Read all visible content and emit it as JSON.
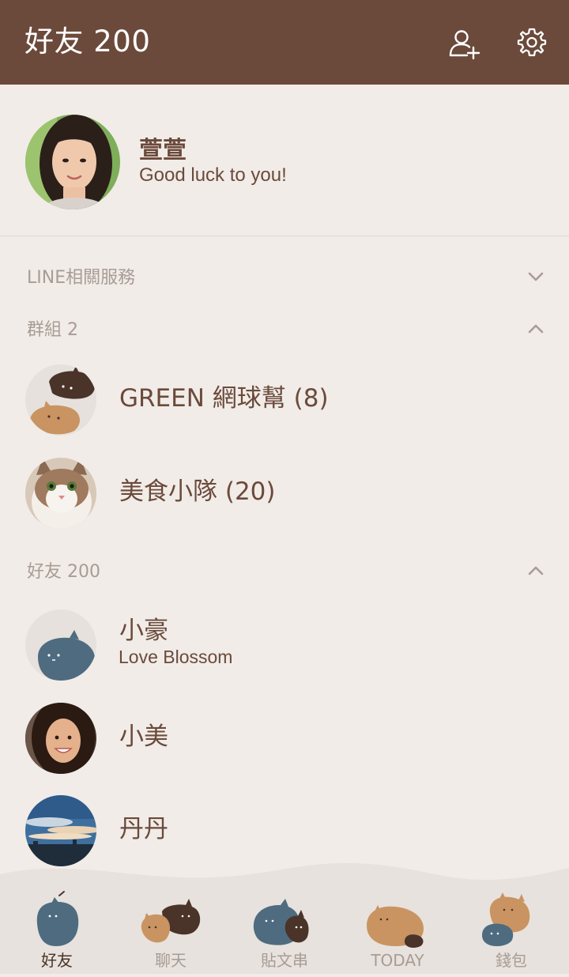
{
  "header": {
    "title": "好友 200",
    "add_friend_icon": "add-friend-icon",
    "settings_icon": "gear-icon"
  },
  "profile": {
    "name": "萱萱",
    "status": "Good luck to you!"
  },
  "sections": {
    "services": {
      "label": "LINE相關服務",
      "state": "collapsed"
    },
    "groups": {
      "label": "群組 2",
      "state": "expanded"
    },
    "friends": {
      "label": "好友 200",
      "state": "expanded"
    }
  },
  "groups": [
    {
      "name": "GREEN 網球幫 (8)"
    },
    {
      "name": "美食小隊 (20)"
    }
  ],
  "friends": [
    {
      "name": "小豪",
      "status": "Love Blossom"
    },
    {
      "name": "小美",
      "status": ""
    },
    {
      "name": "丹丹",
      "status": ""
    }
  ],
  "tabs": [
    {
      "label": "好友",
      "active": true
    },
    {
      "label": "聊天",
      "active": false
    },
    {
      "label": "貼文串",
      "active": false
    },
    {
      "label": "TODAY",
      "active": false
    },
    {
      "label": "錢包",
      "active": false
    }
  ],
  "colors": {
    "header_bg": "#6b4a3b",
    "page_bg": "#f1ece8",
    "text_brown": "#6b4a3b",
    "muted": "#a89c95",
    "cat_blue": "#4f6b80",
    "cat_tan": "#c99462",
    "cat_dark": "#4a3328"
  }
}
